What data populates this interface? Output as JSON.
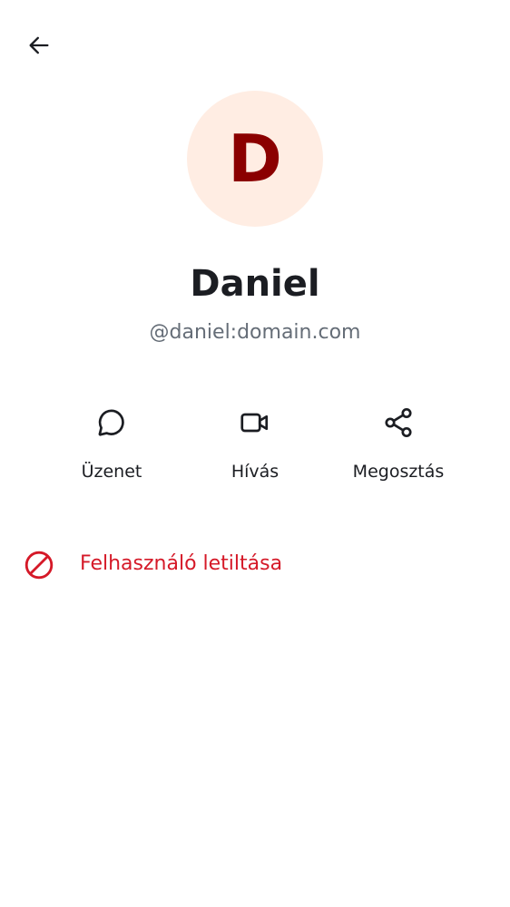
{
  "header": {
    "back_icon": "arrow-left-icon"
  },
  "profile": {
    "avatar_initial": "D",
    "avatar_bg_color": "#ffede3",
    "avatar_fg_color": "#8b0000",
    "display_name": "Daniel",
    "user_id": "@daniel:domain.com"
  },
  "actions": [
    {
      "label": "Üzenet",
      "icon": "chat-bubble-icon"
    },
    {
      "label": "Hívás",
      "icon": "video-camera-icon"
    },
    {
      "label": "Megosztás",
      "icon": "share-icon"
    }
  ],
  "block_user": {
    "label": "Felhasználó letiltása",
    "icon": "block-icon",
    "color": "#d51928"
  }
}
